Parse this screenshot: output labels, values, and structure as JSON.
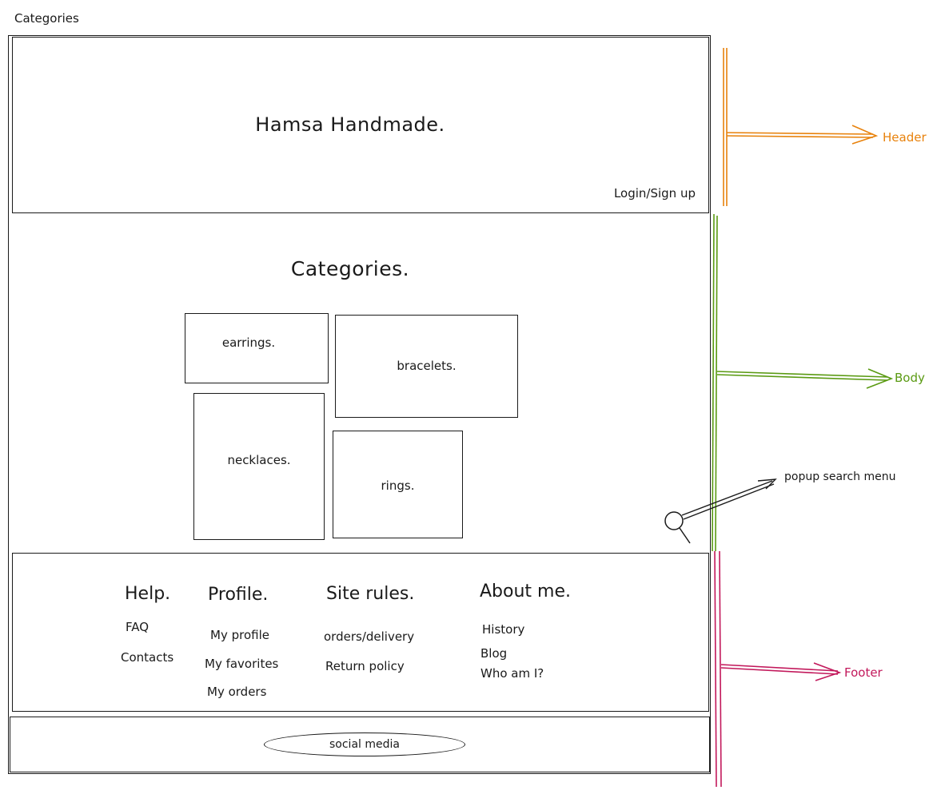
{
  "page_label": "Categories",
  "header": {
    "site_title": "Hamsa Handmade.",
    "login_label": "Login/Sign up"
  },
  "body": {
    "title": "Categories.",
    "categories": [
      {
        "label": "earrings."
      },
      {
        "label": "bracelets."
      },
      {
        "label": "necklaces."
      },
      {
        "label": "rings."
      }
    ],
    "search_annotation": "popup search menu"
  },
  "footer": {
    "columns": [
      {
        "heading": "Help.",
        "links": [
          "FAQ",
          "Contacts"
        ]
      },
      {
        "heading": "Profile.",
        "links": [
          "My profile",
          "My favorites",
          "My orders"
        ]
      },
      {
        "heading": "Site rules.",
        "links": [
          "orders/delivery",
          "Return policy"
        ]
      },
      {
        "heading": "About me.",
        "links": [
          "History",
          "Blog",
          "Who am I?"
        ]
      }
    ],
    "social_label": "social media"
  },
  "annotations": {
    "header": {
      "label": "Header",
      "color": "#e8820c"
    },
    "body": {
      "label": "Body",
      "color": "#5a9a12"
    },
    "footer": {
      "label": "Footer",
      "color": "#c2185b"
    }
  }
}
